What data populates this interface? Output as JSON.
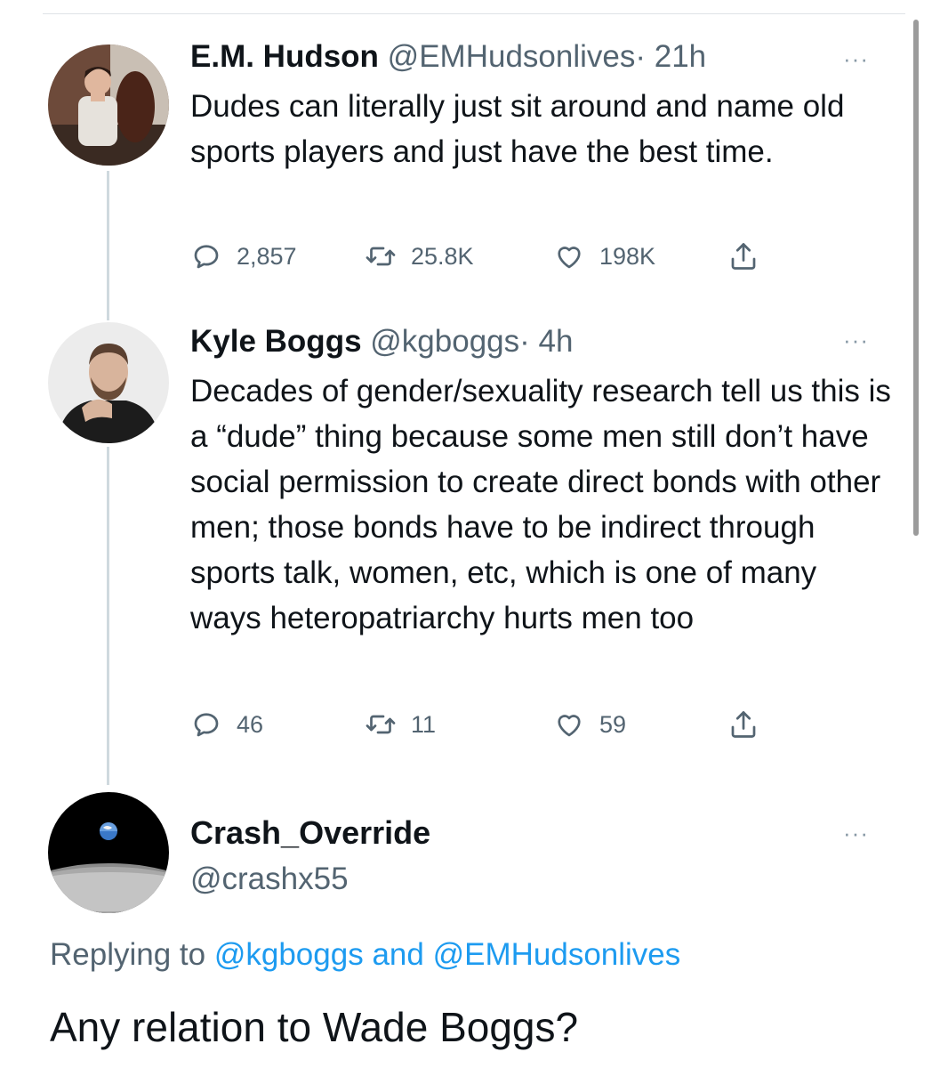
{
  "tweets": [
    {
      "name": "E.M. Hudson",
      "handle": "@EMHudsonlives",
      "time": "· 21h",
      "text": "Dudes can literally just sit around and name old sports players and just have the best time.",
      "replies": "2,857",
      "retweets": "25.8K",
      "likes": "198K",
      "more": "···"
    },
    {
      "name": "Kyle Boggs",
      "handle": "@kgboggs",
      "time": "· 4h",
      "text": "Decades of gender/sexuality research tell us this is a “dude” thing because some men still don’t have social permission to create direct bonds with other men; those bonds have to be indirect through sports talk, women, etc, which is one of many ways heteropatriarchy hurts men too",
      "replies": "46",
      "retweets": "11",
      "likes": "59",
      "more": "···"
    }
  ],
  "main_tweet": {
    "name": "Crash_Override",
    "handle": "@crashx55",
    "more": "···",
    "replying_prefix": "Replying to",
    "replying_user1": "@kgboggs",
    "replying_and": "and",
    "replying_user2": "@EMHudsonlives",
    "text": "Any relation to Wade Boggs?"
  },
  "icons": {
    "reply": "speech-bubble-icon",
    "retweet": "retweet-arrows-icon",
    "like": "heart-outline-icon",
    "share": "share-upload-icon"
  },
  "colors": {
    "text": "#0f1419",
    "secondary": "#536471",
    "link": "#1d9bf0",
    "thread_line": "#cfd9de"
  }
}
